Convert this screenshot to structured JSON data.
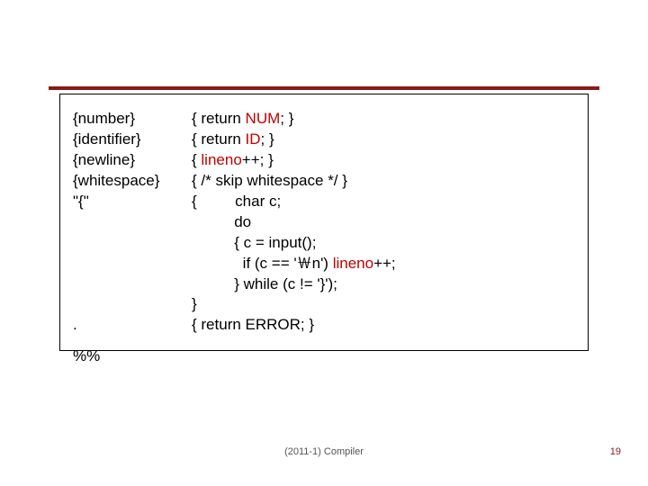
{
  "rows": [
    {
      "left": "{number}",
      "right_pre": "{ return ",
      "right_hl": "NUM",
      "right_post": "; }"
    },
    {
      "left": "{identifier}",
      "right_pre": "{ return ",
      "right_hl": "ID",
      "right_post": "; }"
    },
    {
      "left": "{newline}",
      "right_pre": "{ ",
      "right_hl": "lineno",
      "right_post": "++; }"
    },
    {
      "left": "{whitespace}",
      "right_pre": "{ /* skip whitespace */ }",
      "right_hl": "",
      "right_post": ""
    },
    {
      "left": "\"{\"",
      "right_pre": "{         char c;",
      "right_hl": "",
      "right_post": ""
    },
    {
      "left": "",
      "right_pre": "          do",
      "right_hl": "",
      "right_post": ""
    },
    {
      "left": "",
      "right_pre": "          { c = input();",
      "right_hl": "",
      "right_post": ""
    },
    {
      "left": "",
      "right_pre": "            if (c == '￦n') ",
      "right_hl": "lineno",
      "right_post": "++;"
    },
    {
      "left": "",
      "right_pre": "          } while (c != '}');",
      "right_hl": "",
      "right_post": ""
    },
    {
      "left": "",
      "right_pre": "}",
      "right_hl": "",
      "right_post": ""
    },
    {
      "left": ".",
      "right_pre": "{ return ERROR; }",
      "right_hl": "",
      "right_post": ""
    }
  ],
  "end_marker": "%%",
  "footer": {
    "center": "(2011-1) Compiler",
    "page": "19"
  }
}
